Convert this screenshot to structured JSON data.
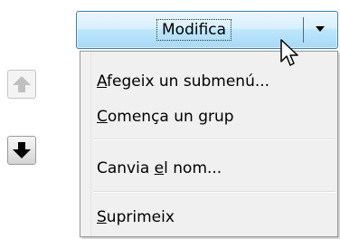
{
  "toolbar": {
    "split_button_label": "Modifica"
  },
  "icons": {
    "dropdown_arrow": "chevron-down-icon",
    "move_up": "arrow-up-icon",
    "move_down": "arrow-down-icon",
    "cursor": "mouse-pointer-icon"
  },
  "move_buttons": {
    "up_enabled": false,
    "down_enabled": true
  },
  "menu": {
    "items": [
      {
        "accel": "A",
        "rest": "fegeix un submenú...",
        "enabled": true
      },
      {
        "accel": "C",
        "rest": "omença un grup",
        "enabled": true
      },
      {
        "pre": "Canvia ",
        "accel": "e",
        "rest": "l nom...",
        "enabled": true
      },
      {
        "accel": "S",
        "rest": "uprimeix",
        "enabled": true
      }
    ]
  },
  "colors": {
    "button_border": "#3c7fb1",
    "button_fill_top": "#eaf6fd",
    "button_fill_bottom": "#a7d9f5",
    "menu_background": "#f0f0f0",
    "menu_border": "#979797",
    "disabled_arrow": "#c0c0c0",
    "enabled_arrow": "#000000"
  }
}
